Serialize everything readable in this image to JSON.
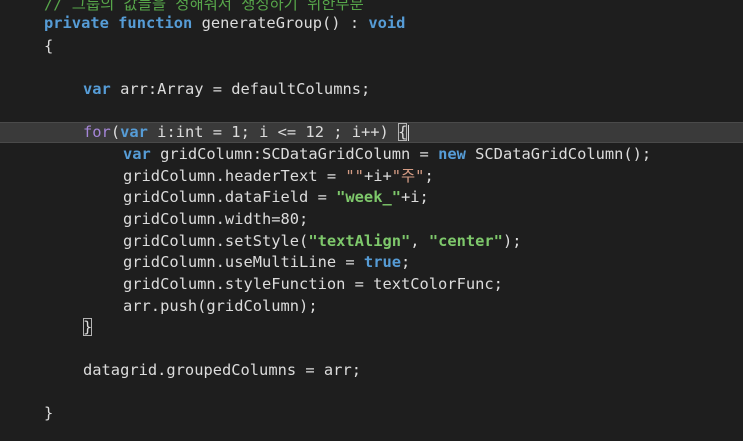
{
  "editor": {
    "lines": [
      {
        "indent": 0,
        "tokens": [
          {
            "t": "// 그룹의 값들을 정해줘서 생성하기 위한부분",
            "c": "comment"
          }
        ]
      },
      {
        "indent": 0,
        "tokens": [
          {
            "t": "private",
            "c": "kw"
          },
          {
            "t": " ",
            "c": "plain"
          },
          {
            "t": "function",
            "c": "kw"
          },
          {
            "t": " generateGroup() : ",
            "c": "plain"
          },
          {
            "t": "void",
            "c": "kw"
          }
        ]
      },
      {
        "indent": 0,
        "tokens": [
          {
            "t": "{",
            "c": "plain"
          }
        ]
      },
      {
        "indent": 0,
        "tokens": []
      },
      {
        "indent": 1,
        "tokens": [
          {
            "t": "var",
            "c": "kw"
          },
          {
            "t": " arr:Array = defaultColumns;",
            "c": "plain"
          }
        ]
      },
      {
        "indent": 0,
        "tokens": []
      },
      {
        "indent": 1,
        "current": true,
        "tokens": [
          {
            "t": "for",
            "c": "kw2"
          },
          {
            "t": "(",
            "c": "plain"
          },
          {
            "t": "var",
            "c": "kw"
          },
          {
            "t": " i:int = 1; i <= 12 ; i++) ",
            "c": "plain"
          },
          {
            "t": "{",
            "c": "plain",
            "box": true
          }
        ]
      },
      {
        "indent": 2,
        "tokens": [
          {
            "t": "var",
            "c": "kw"
          },
          {
            "t": " gridColumn:SCDataGridColumn = ",
            "c": "plain"
          },
          {
            "t": "new",
            "c": "kw"
          },
          {
            "t": " SCDataGridColumn();",
            "c": "plain"
          }
        ]
      },
      {
        "indent": 2,
        "tokens": [
          {
            "t": "gridColumn.headerText = ",
            "c": "plain"
          },
          {
            "t": "\"\"",
            "c": "str"
          },
          {
            "t": "+i+",
            "c": "plain"
          },
          {
            "t": "\"주\"",
            "c": "str"
          },
          {
            "t": ";",
            "c": "plain"
          }
        ]
      },
      {
        "indent": 2,
        "tokens": [
          {
            "t": "gridColumn.dataField = ",
            "c": "plain"
          },
          {
            "t": "\"week_\"",
            "c": "strb"
          },
          {
            "t": "+i;",
            "c": "plain"
          }
        ]
      },
      {
        "indent": 2,
        "tokens": [
          {
            "t": "gridColumn.width=80;",
            "c": "plain"
          }
        ]
      },
      {
        "indent": 2,
        "tokens": [
          {
            "t": "gridColumn.setStyle(",
            "c": "plain"
          },
          {
            "t": "\"textAlign\"",
            "c": "strb"
          },
          {
            "t": ", ",
            "c": "plain"
          },
          {
            "t": "\"center\"",
            "c": "strb"
          },
          {
            "t": ");",
            "c": "plain"
          }
        ]
      },
      {
        "indent": 2,
        "tokens": [
          {
            "t": "gridColumn.useMultiLine = ",
            "c": "plain"
          },
          {
            "t": "true",
            "c": "kw"
          },
          {
            "t": ";",
            "c": "plain"
          }
        ]
      },
      {
        "indent": 2,
        "tokens": [
          {
            "t": "gridColumn.styleFunction = textColorFunc;",
            "c": "plain"
          }
        ]
      },
      {
        "indent": 2,
        "tokens": [
          {
            "t": "arr.push(gridColumn);",
            "c": "plain"
          }
        ]
      },
      {
        "indent": 1,
        "tokens": [
          {
            "t": "}",
            "c": "plain",
            "box": true
          }
        ]
      },
      {
        "indent": 0,
        "tokens": []
      },
      {
        "indent": 1,
        "tokens": [
          {
            "t": "datagrid.groupedColumns = arr;",
            "c": "plain"
          }
        ]
      },
      {
        "indent": 0,
        "tokens": []
      },
      {
        "indent": 0,
        "tokens": [
          {
            "t": "}",
            "c": "plain"
          }
        ]
      }
    ]
  }
}
